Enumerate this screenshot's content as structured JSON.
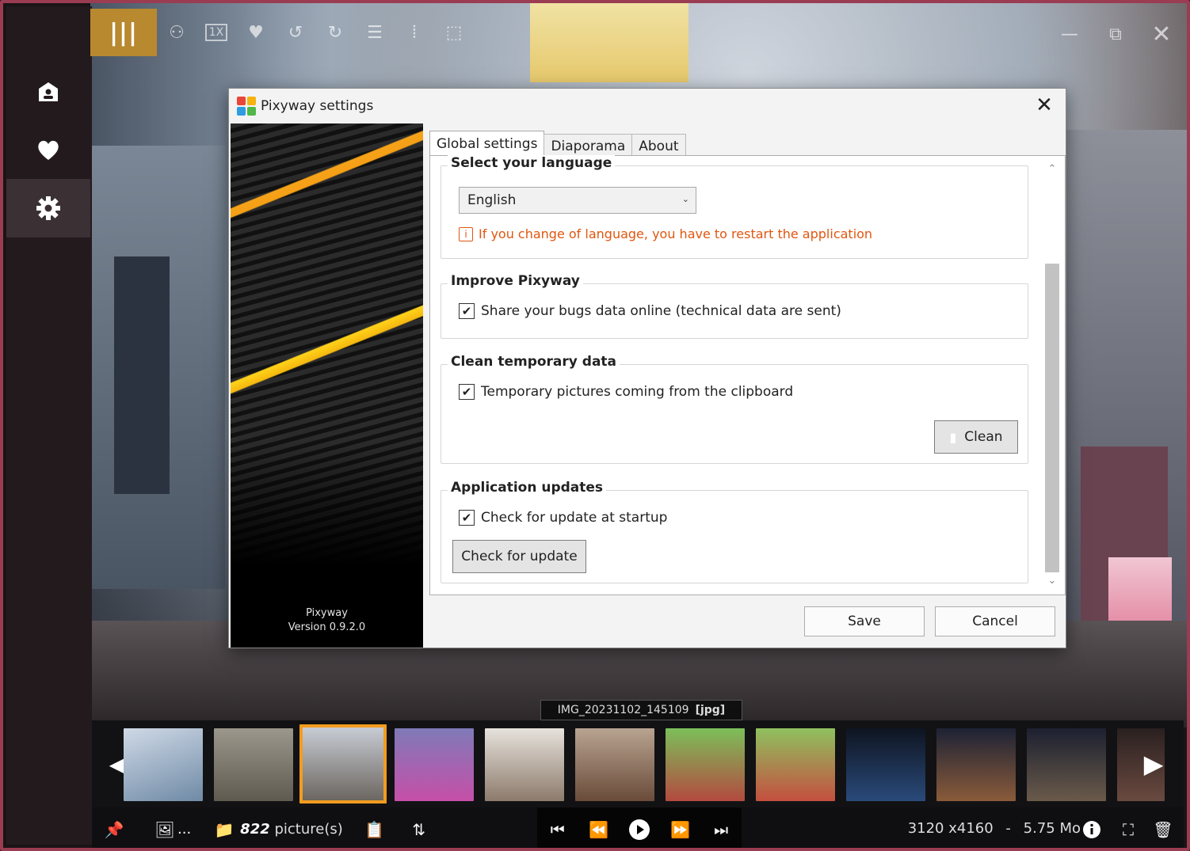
{
  "window": {
    "title": "Pixyway settings"
  },
  "sidebar": {
    "items": [
      {
        "icon": "home-folder-icon"
      },
      {
        "icon": "heart-icon"
      },
      {
        "icon": "gear-icon",
        "active": true
      }
    ]
  },
  "toolbar": {
    "menu_icon": "|||",
    "zoom_label": "1X",
    "icons": [
      "slideshow-icon",
      "zoom-1x-icon",
      "heart-icon",
      "rotate-left-icon",
      "rotate-right-icon",
      "compare-icon",
      "split-icon",
      "crop-icon"
    ],
    "window_icons": [
      "minimize-icon",
      "restore-icon",
      "close-icon"
    ]
  },
  "dialog": {
    "title": "Pixyway settings",
    "banner": {
      "app_name": "Pixyway",
      "version": "Version 0.9.2.0"
    },
    "tabs": [
      {
        "label": "Global settings",
        "active": true
      },
      {
        "label": "Diaporama",
        "active": false
      },
      {
        "label": "About",
        "active": false
      }
    ],
    "language": {
      "title": "Select your language",
      "selected": "English",
      "warning": "If you change of language, you have to restart the application"
    },
    "improve": {
      "title": "Improve Pixyway",
      "checkbox_label": "Share your bugs data online (technical data are sent)",
      "checked": true
    },
    "clean": {
      "title": "Clean temporary data",
      "checkbox_label": "Temporary pictures coming from the clipboard",
      "checked": true,
      "button_label": "Clean"
    },
    "updates": {
      "title": "Application updates",
      "checkbox_label": "Check for update at startup",
      "checked": true,
      "button_label": "Check for update"
    },
    "save_label": "Save",
    "cancel_label": "Cancel"
  },
  "viewer": {
    "caption_name": "IMG_20231102_145109",
    "caption_ext": "[jpg]",
    "thumbnails": [
      {
        "color": "#8fa6c0"
      },
      {
        "color": "#7b7a6a"
      },
      {
        "color": "#8a8f99",
        "selected": true
      },
      {
        "color": "#c64fa8"
      },
      {
        "color": "#b7a391"
      },
      {
        "color": "#8b6f5a"
      },
      {
        "color": "#4f8f3f"
      },
      {
        "color": "#5f9448"
      },
      {
        "color": "#1c2a44"
      },
      {
        "color": "#3a2f44"
      },
      {
        "color": "#2a2f3a"
      },
      {
        "color": "#3c3330"
      }
    ],
    "picture_count": "822",
    "picture_unit": "picture(s)",
    "dimensions": "3120 x4160",
    "separator": "-",
    "file_size": "5.75 Mo",
    "ellipsis": "..."
  }
}
